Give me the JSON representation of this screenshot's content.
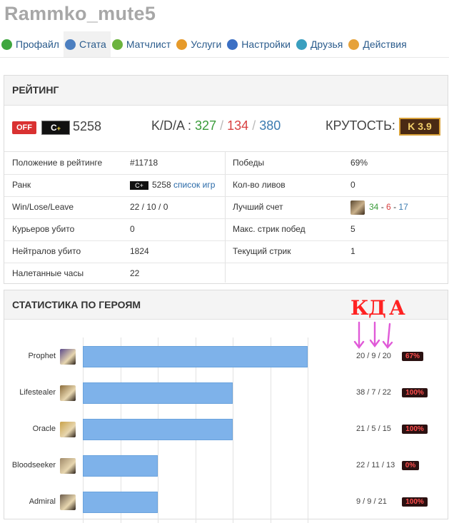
{
  "profile": {
    "username": "Rammko_mute5"
  },
  "nav": [
    {
      "label": "Профайл",
      "icon": "profile-icon",
      "color": "#3ea63e"
    },
    {
      "label": "Стата",
      "icon": "stats-icon",
      "color": "#4c7fc0",
      "active": true
    },
    {
      "label": "Матчлист",
      "icon": "matchlist-icon",
      "color": "#6cb33e"
    },
    {
      "label": "Услуги",
      "icon": "services-icon",
      "color": "#e69a2a"
    },
    {
      "label": "Настройки",
      "icon": "settings-icon",
      "color": "#3b6fc4"
    },
    {
      "label": "Друзья",
      "icon": "friends-icon",
      "color": "#3a9fbf"
    },
    {
      "label": "Действия",
      "icon": "actions-icon",
      "color": "#e6a23a"
    }
  ],
  "rating": {
    "title": "РЕЙТИНГ",
    "off_label": "OFF",
    "rank_label": "C",
    "rank_plus": "+",
    "rating_value": "5258",
    "kda_label": "K/D/A :",
    "kills": "327",
    "deaths": "134",
    "assists": "380",
    "slash": "/",
    "krutost_label": "КРУТОСТЬ:",
    "krutost_value": "K 3.9",
    "colors": {
      "kills": "#3a9b3a",
      "deaths": "#d84040",
      "assists": "#3b7bb0"
    }
  },
  "stats": {
    "left": [
      {
        "label": "Положение в рейтинге",
        "value": "#11718"
      },
      {
        "label": "Ранк",
        "value": "5258",
        "link": "список игр",
        "rank_mini": "C+"
      },
      {
        "label": "Win/Lose/Leave",
        "value": "22 / 10 / 0"
      },
      {
        "label": "Курьеров убито",
        "value": "0"
      },
      {
        "label": "Нейтралов убито",
        "value": "1824"
      },
      {
        "label": "Налетанные часы",
        "value": "22"
      }
    ],
    "right": [
      {
        "label": "Победы",
        "value": "69%"
      },
      {
        "label": "Кол-во ливов",
        "value": "0"
      },
      {
        "label": "Лучший счет",
        "kills": "34",
        "deaths": "6",
        "assists": "17",
        "dash": "-"
      },
      {
        "label": "Макс. стрик побед",
        "value": "5"
      },
      {
        "label": "Текущий стрик",
        "value": "1"
      }
    ]
  },
  "heroes": {
    "title": "СТАТИСТИКА ПО ГЕРОЯМ",
    "annotation": {
      "k": "К",
      "d": "Д",
      "a": "А"
    },
    "rows": [
      {
        "name": "Prophet",
        "games": 6,
        "kda": "20 / 9 / 20",
        "winrate": "67%",
        "avatar_color": "#5b4a8a"
      },
      {
        "name": "Lifestealer",
        "games": 4,
        "kda": "38 / 7 / 22",
        "winrate": "100%",
        "avatar_color": "#8a6b3a"
      },
      {
        "name": "Oracle",
        "games": 4,
        "kda": "21 / 5 / 15",
        "winrate": "100%",
        "avatar_color": "#c9a24a"
      },
      {
        "name": "Bloodseeker",
        "games": 2,
        "kda": "22 / 11 / 13",
        "winrate": "0%",
        "avatar_color": "#a08a6a"
      },
      {
        "name": "Admiral",
        "games": 2,
        "kda": "9 / 9 / 21",
        "winrate": "100%",
        "avatar_color": "#6a5a4a"
      }
    ]
  }
}
